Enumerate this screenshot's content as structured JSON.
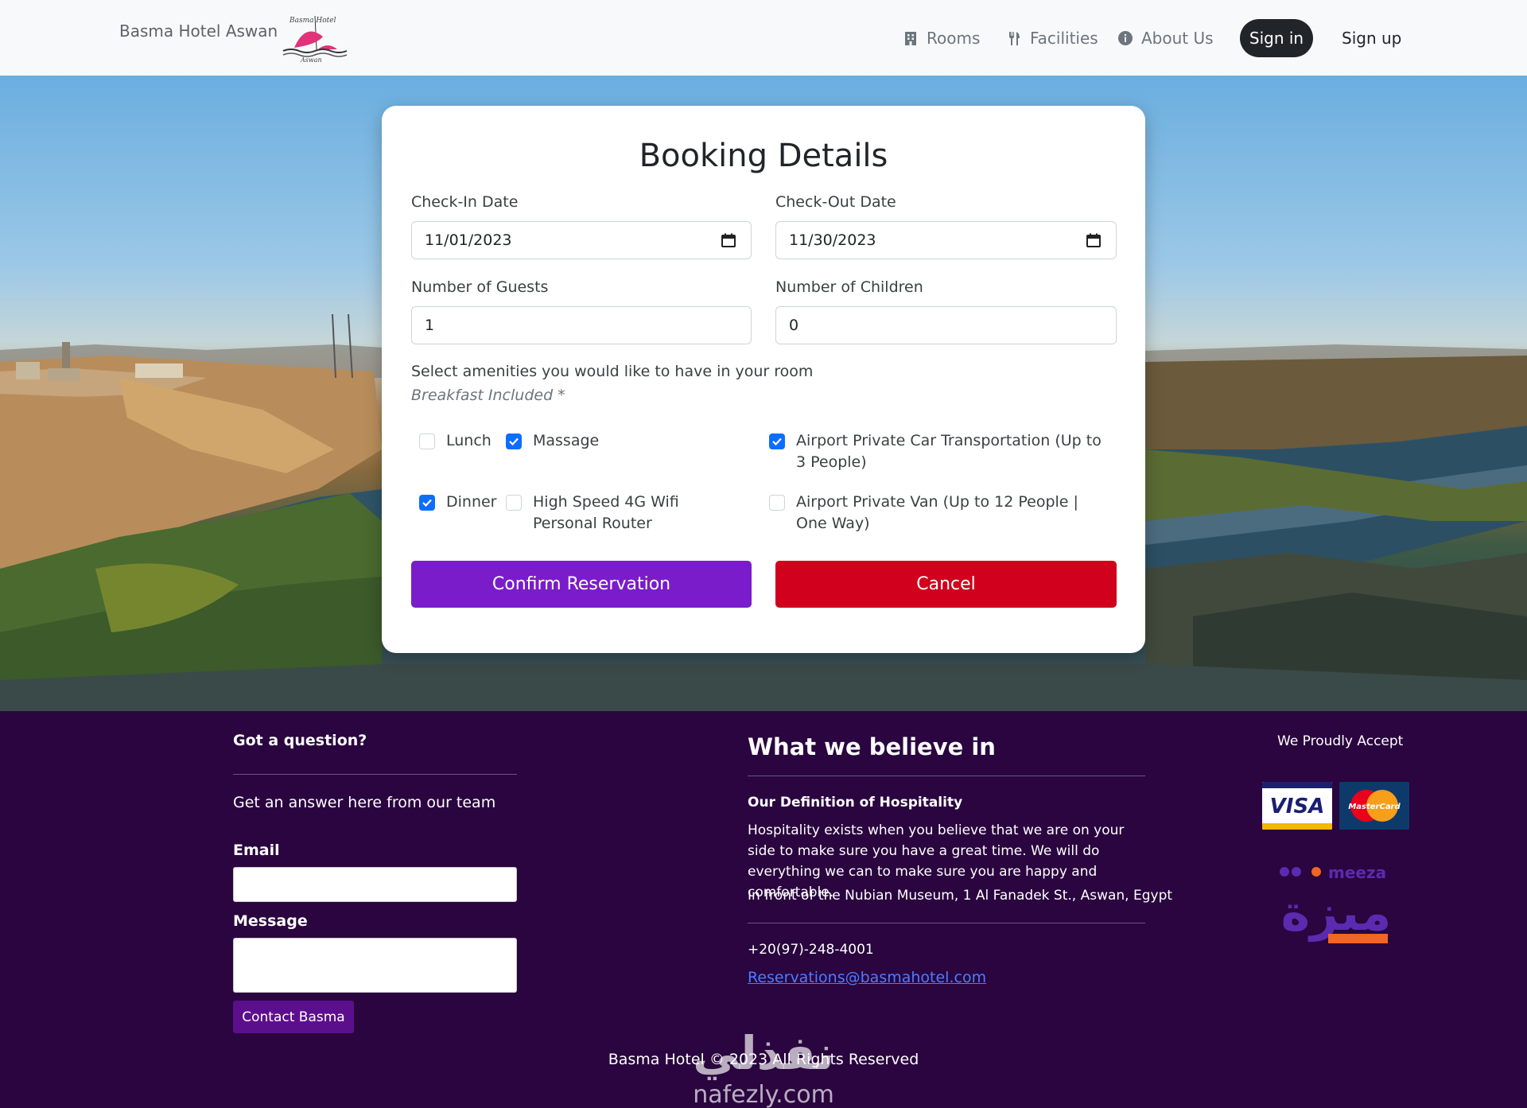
{
  "nav": {
    "brand": "Basma Hotel Aswan",
    "logo_text_top": "Basma Hotel",
    "logo_text_bottom": "Aswan",
    "links": [
      {
        "label": "Rooms",
        "icon": "building-icon"
      },
      {
        "label": "Facilities",
        "icon": "utensils-icon"
      },
      {
        "label": "About Us",
        "icon": "info-icon"
      }
    ],
    "sign_in": "Sign in",
    "sign_up": "Sign up"
  },
  "booking": {
    "title": "Booking Details",
    "check_in_label": "Check-In Date",
    "check_in_value": "11/01/2023",
    "check_out_label": "Check-Out Date",
    "check_out_value": "11/30/2023",
    "guests_label": "Number of Guests",
    "guests_value": "1",
    "children_label": "Number of Children",
    "children_value": "0",
    "amenities_title": "Select amenities you would like to have in your room",
    "amenities_note": "Breakfast Included *",
    "amenities": [
      {
        "label": "Lunch",
        "checked": false
      },
      {
        "label": "Massage",
        "checked": true
      },
      {
        "label": "Airport Private Car Transportation (Up to 3 People)",
        "checked": true
      },
      {
        "label": "Dinner",
        "checked": true
      },
      {
        "label": "High Speed 4G Wifi Personal Router",
        "checked": false
      },
      {
        "label": "Airport Private Van (Up to 12 People | One Way)",
        "checked": false
      }
    ],
    "confirm": "Confirm Reservation",
    "cancel": "Cancel"
  },
  "footer": {
    "question_title": "Got a question?",
    "question_sub": "Get an answer here from our team",
    "email_label": "Email",
    "message_label": "Message",
    "contact_button": "Contact Basma",
    "believe_title": "What we believe in",
    "definition_title": "Our Definition of Hospitality",
    "definition_body": "Hospitality exists when you believe that we are on your side to make sure you have a great time. We will do everything we can to make sure you are happy and comfortable.",
    "address": "In front of the Nubian Museum, 1 Al Fanadek St., Aswan, Egypt",
    "phone": "+20(97)-248-4001",
    "email": "Reservations@basmahotel.com",
    "accept_title": "We Proudly Accept",
    "visa": "VISA",
    "mastercard": "MasterCard",
    "meeza_latin": "meeza",
    "meeza_arabic": "ميزة",
    "copyright": "Basma Hotel © 2023 All Rights Reserved",
    "watermark_arabic": "نفذلي",
    "watermark_latin": "nafezly.com"
  },
  "colors": {
    "confirm": "#7a1cca",
    "cancel": "#d1001c",
    "footer_bg": "#2a053f",
    "checkbox_on": "#0d6efd"
  }
}
